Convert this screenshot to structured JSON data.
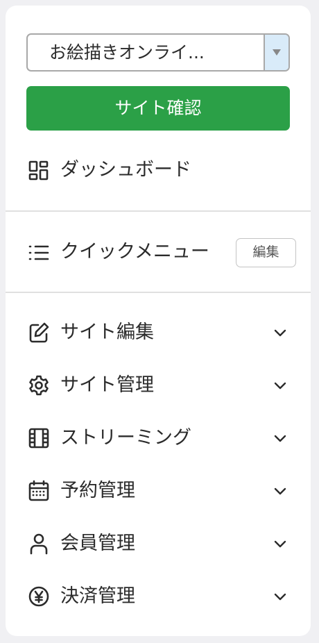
{
  "site_selector": {
    "value": "お絵描きオンライ..."
  },
  "site_check_button": {
    "label": "サイト確認"
  },
  "dashboard": {
    "label": "ダッシュボード",
    "icon": "dashboard-icon"
  },
  "quick_menu": {
    "label": "クイックメニュー",
    "edit_label": "編集",
    "icon": "list-icon"
  },
  "menu": {
    "items": [
      {
        "label": "サイト編集",
        "icon": "pencil-square-icon"
      },
      {
        "label": "サイト管理",
        "icon": "gear-icon"
      },
      {
        "label": "ストリーミング",
        "icon": "film-icon"
      },
      {
        "label": "予約管理",
        "icon": "calendar-icon"
      },
      {
        "label": "会員管理",
        "icon": "user-icon"
      },
      {
        "label": "決済管理",
        "icon": "yen-icon"
      }
    ]
  },
  "colors": {
    "primary_button": "#2ba047",
    "select_arrow_bg": "#d9ebf9",
    "panel_bg": "#ffffff",
    "page_bg": "#f0f0f3"
  }
}
